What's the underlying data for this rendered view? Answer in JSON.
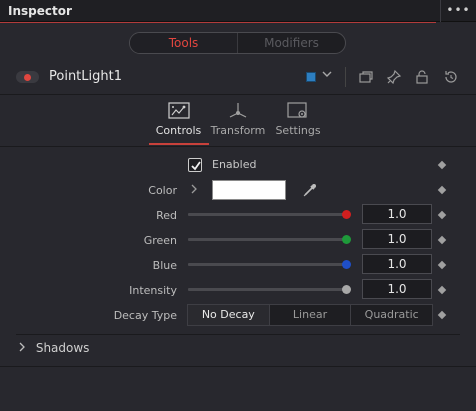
{
  "panel": {
    "title": "Inspector",
    "menu_icon": "more-dots-icon",
    "accent_color": "#b23b3b"
  },
  "mode_switch": {
    "tools_label": "Tools",
    "modifiers_label": "Modifiers",
    "active": "Tools"
  },
  "node": {
    "name": "PointLight1",
    "enabled_toggle": true,
    "color_tag": "#2d7ec0"
  },
  "header_icons": [
    "color-tag-dropdown-icon",
    "versions-icon",
    "pin-icon",
    "lock-icon",
    "reset-icon"
  ],
  "tabs": [
    {
      "label": "Controls",
      "icon": "controls-icon",
      "active": true
    },
    {
      "label": "Transform",
      "icon": "transform-icon",
      "active": false
    },
    {
      "label": "Settings",
      "icon": "settings-icon",
      "active": false
    }
  ],
  "controls": {
    "enabled": {
      "label": "Enabled",
      "checked": true
    },
    "color": {
      "label": "Color",
      "value": "#ffffff"
    },
    "red": {
      "label": "Red",
      "value": "1.0",
      "knob_color": "#d21f1f"
    },
    "green": {
      "label": "Green",
      "value": "1.0",
      "knob_color": "#1e9a3a"
    },
    "blue": {
      "label": "Blue",
      "value": "1.0",
      "knob_color": "#1f4fc8"
    },
    "intensity": {
      "label": "Intensity",
      "value": "1.0",
      "knob_color": "#a8a8a8"
    },
    "decay_type": {
      "label": "Decay Type",
      "options": [
        "No Decay",
        "Linear",
        "Quadratic"
      ],
      "selected": "No Decay"
    }
  },
  "sections": {
    "shadows": {
      "label": "Shadows",
      "expanded": false
    }
  }
}
